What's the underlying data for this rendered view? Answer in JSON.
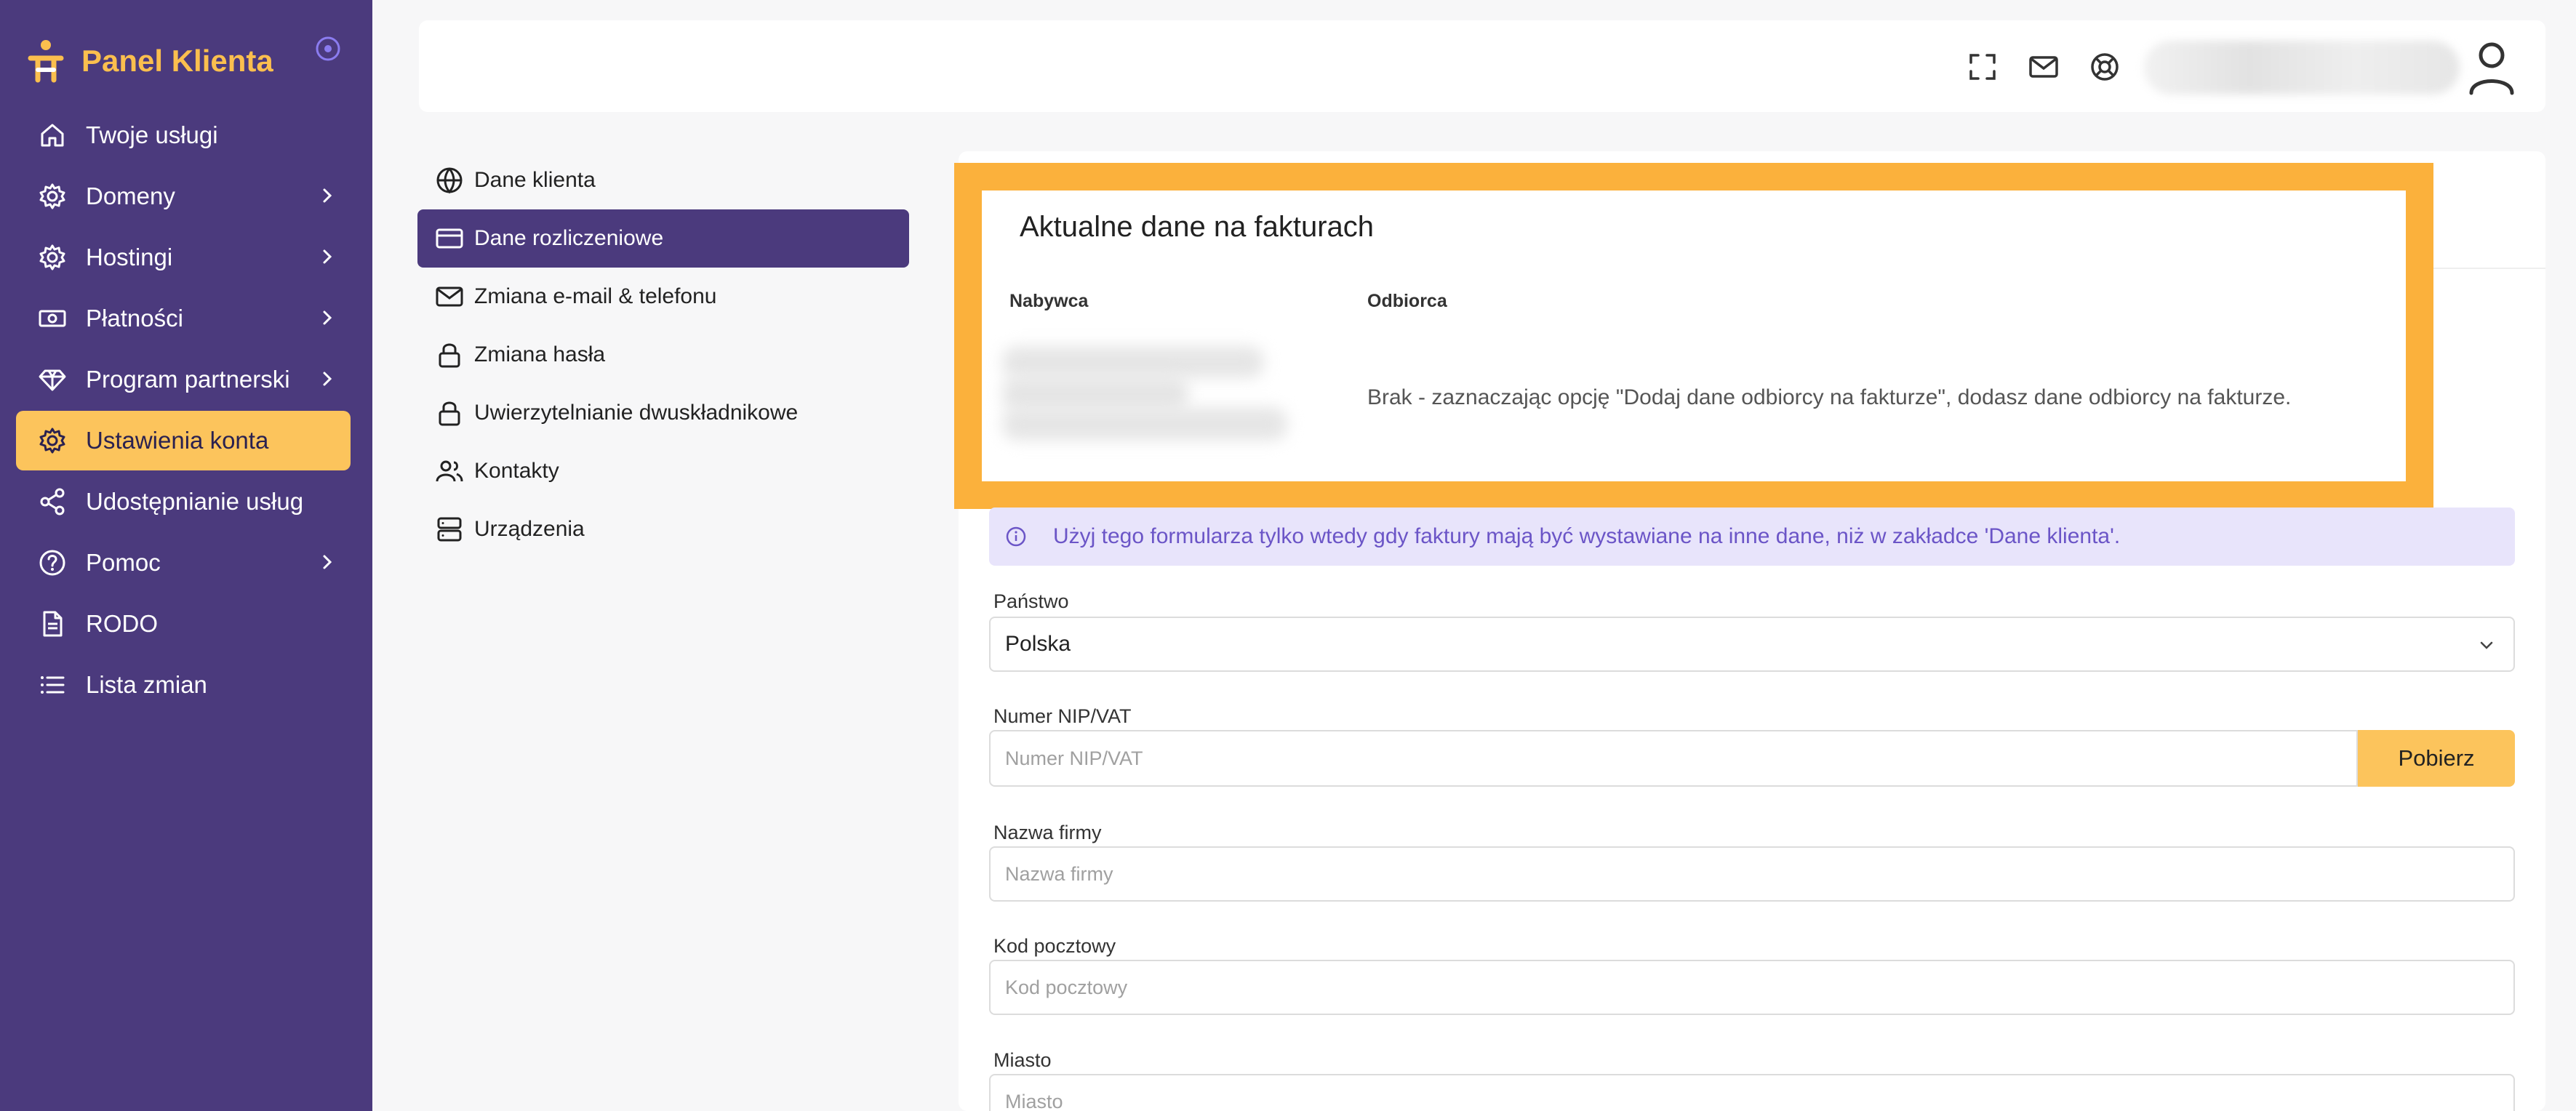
{
  "brand": {
    "title": "Panel Klienta"
  },
  "sidebar": {
    "items": [
      {
        "label": "Twoje usługi",
        "icon": "home-icon"
      },
      {
        "label": "Domeny",
        "icon": "gear-icon"
      },
      {
        "label": "Hostingi",
        "icon": "gear-icon"
      },
      {
        "label": "Płatności",
        "icon": "banknote-icon"
      },
      {
        "label": "Program partnerski",
        "icon": "diamond-icon"
      },
      {
        "label": "Ustawienia konta",
        "icon": "gear-icon"
      },
      {
        "label": "Udostępnianie usług",
        "icon": "share-icon"
      },
      {
        "label": "Pomoc",
        "icon": "help-circle-icon"
      },
      {
        "label": "RODO",
        "icon": "document-icon"
      },
      {
        "label": "Lista zmian",
        "icon": "list-icon"
      }
    ]
  },
  "settings_menu": {
    "items": [
      {
        "label": "Dane klienta",
        "icon": "globe-icon"
      },
      {
        "label": "Dane rozliczeniowe",
        "icon": "credit-card-icon"
      },
      {
        "label": "Zmiana e-mail & telefonu",
        "icon": "mail-icon"
      },
      {
        "label": "Zmiana hasła",
        "icon": "lock-icon"
      },
      {
        "label": "Uwierzytelnianie dwuskładnikowe",
        "icon": "lock-icon"
      },
      {
        "label": "Kontakty",
        "icon": "users-icon"
      },
      {
        "label": "Urządzenia",
        "icon": "server-icon"
      }
    ]
  },
  "invoice": {
    "title": "Aktualne dane na fakturach",
    "buyer_label": "Nabywca",
    "recipient_label": "Odbiorca",
    "recipient_text": "Brak - zaznaczając opcję \"Dodaj dane odbiorcy na fakturze\", dodasz dane odbiorcy na fakturze."
  },
  "alert": {
    "text": "Użyj tego formularza tylko wtedy gdy faktury mają być wystawiane na inne dane, niż w zakładce 'Dane klienta'."
  },
  "form": {
    "country": {
      "label": "Państwo",
      "value": "Polska"
    },
    "nip": {
      "label": "Numer NIP/VAT",
      "placeholder": "Numer NIP/VAT",
      "button": "Pobierz"
    },
    "company": {
      "label": "Nazwa firmy",
      "placeholder": "Nazwa firmy"
    },
    "postal": {
      "label": "Kod pocztowy",
      "placeholder": "Kod pocztowy"
    },
    "city": {
      "label": "Miasto",
      "placeholder": "Miasto"
    }
  },
  "colors": {
    "sidebar": "#4b3a7d",
    "accent": "#fcc45c",
    "highlight": "#fbb13c",
    "alert_bg": "#e8e4fb",
    "alert_text": "#6b55c7"
  }
}
